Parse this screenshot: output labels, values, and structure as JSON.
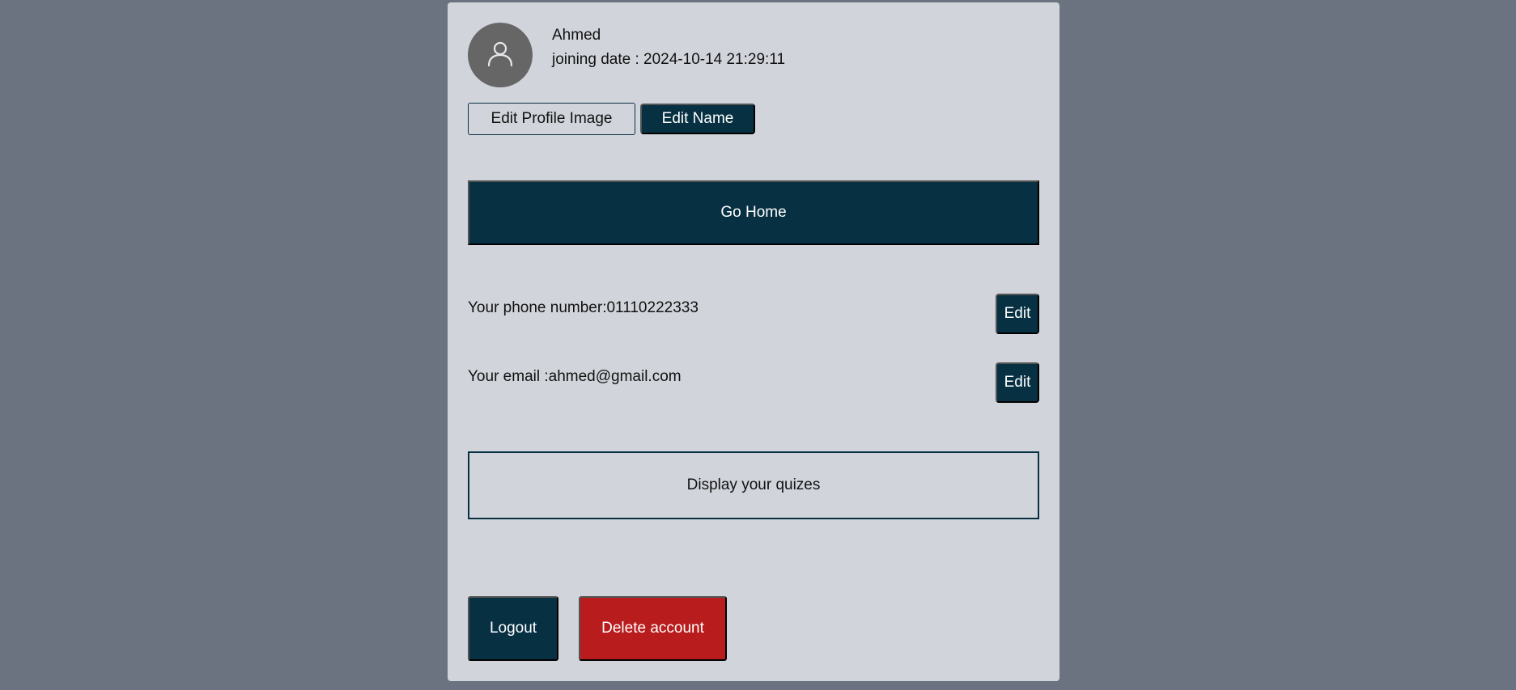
{
  "profile": {
    "name": "Ahmed",
    "joining_date": "joining date : 2024-10-14 21:29:11",
    "avatar_icon": "user-icon"
  },
  "actions": {
    "edit_profile_image": "Edit Profile Image",
    "edit_name": "Edit Name",
    "go_home": "Go Home",
    "display_quizes": "Display your quizes",
    "logout": "Logout",
    "delete_account": "Delete account"
  },
  "contact": {
    "phone": "Your phone number:01110222333",
    "phone_edit": "Edit",
    "email": "Your email :ahmed@gmail.com",
    "email_edit": "Edit"
  },
  "colors": {
    "page_background": "#6b7280",
    "card_background": "#d1d5db",
    "primary": "#073143",
    "danger": "#b91c1c",
    "avatar": "#666666"
  }
}
